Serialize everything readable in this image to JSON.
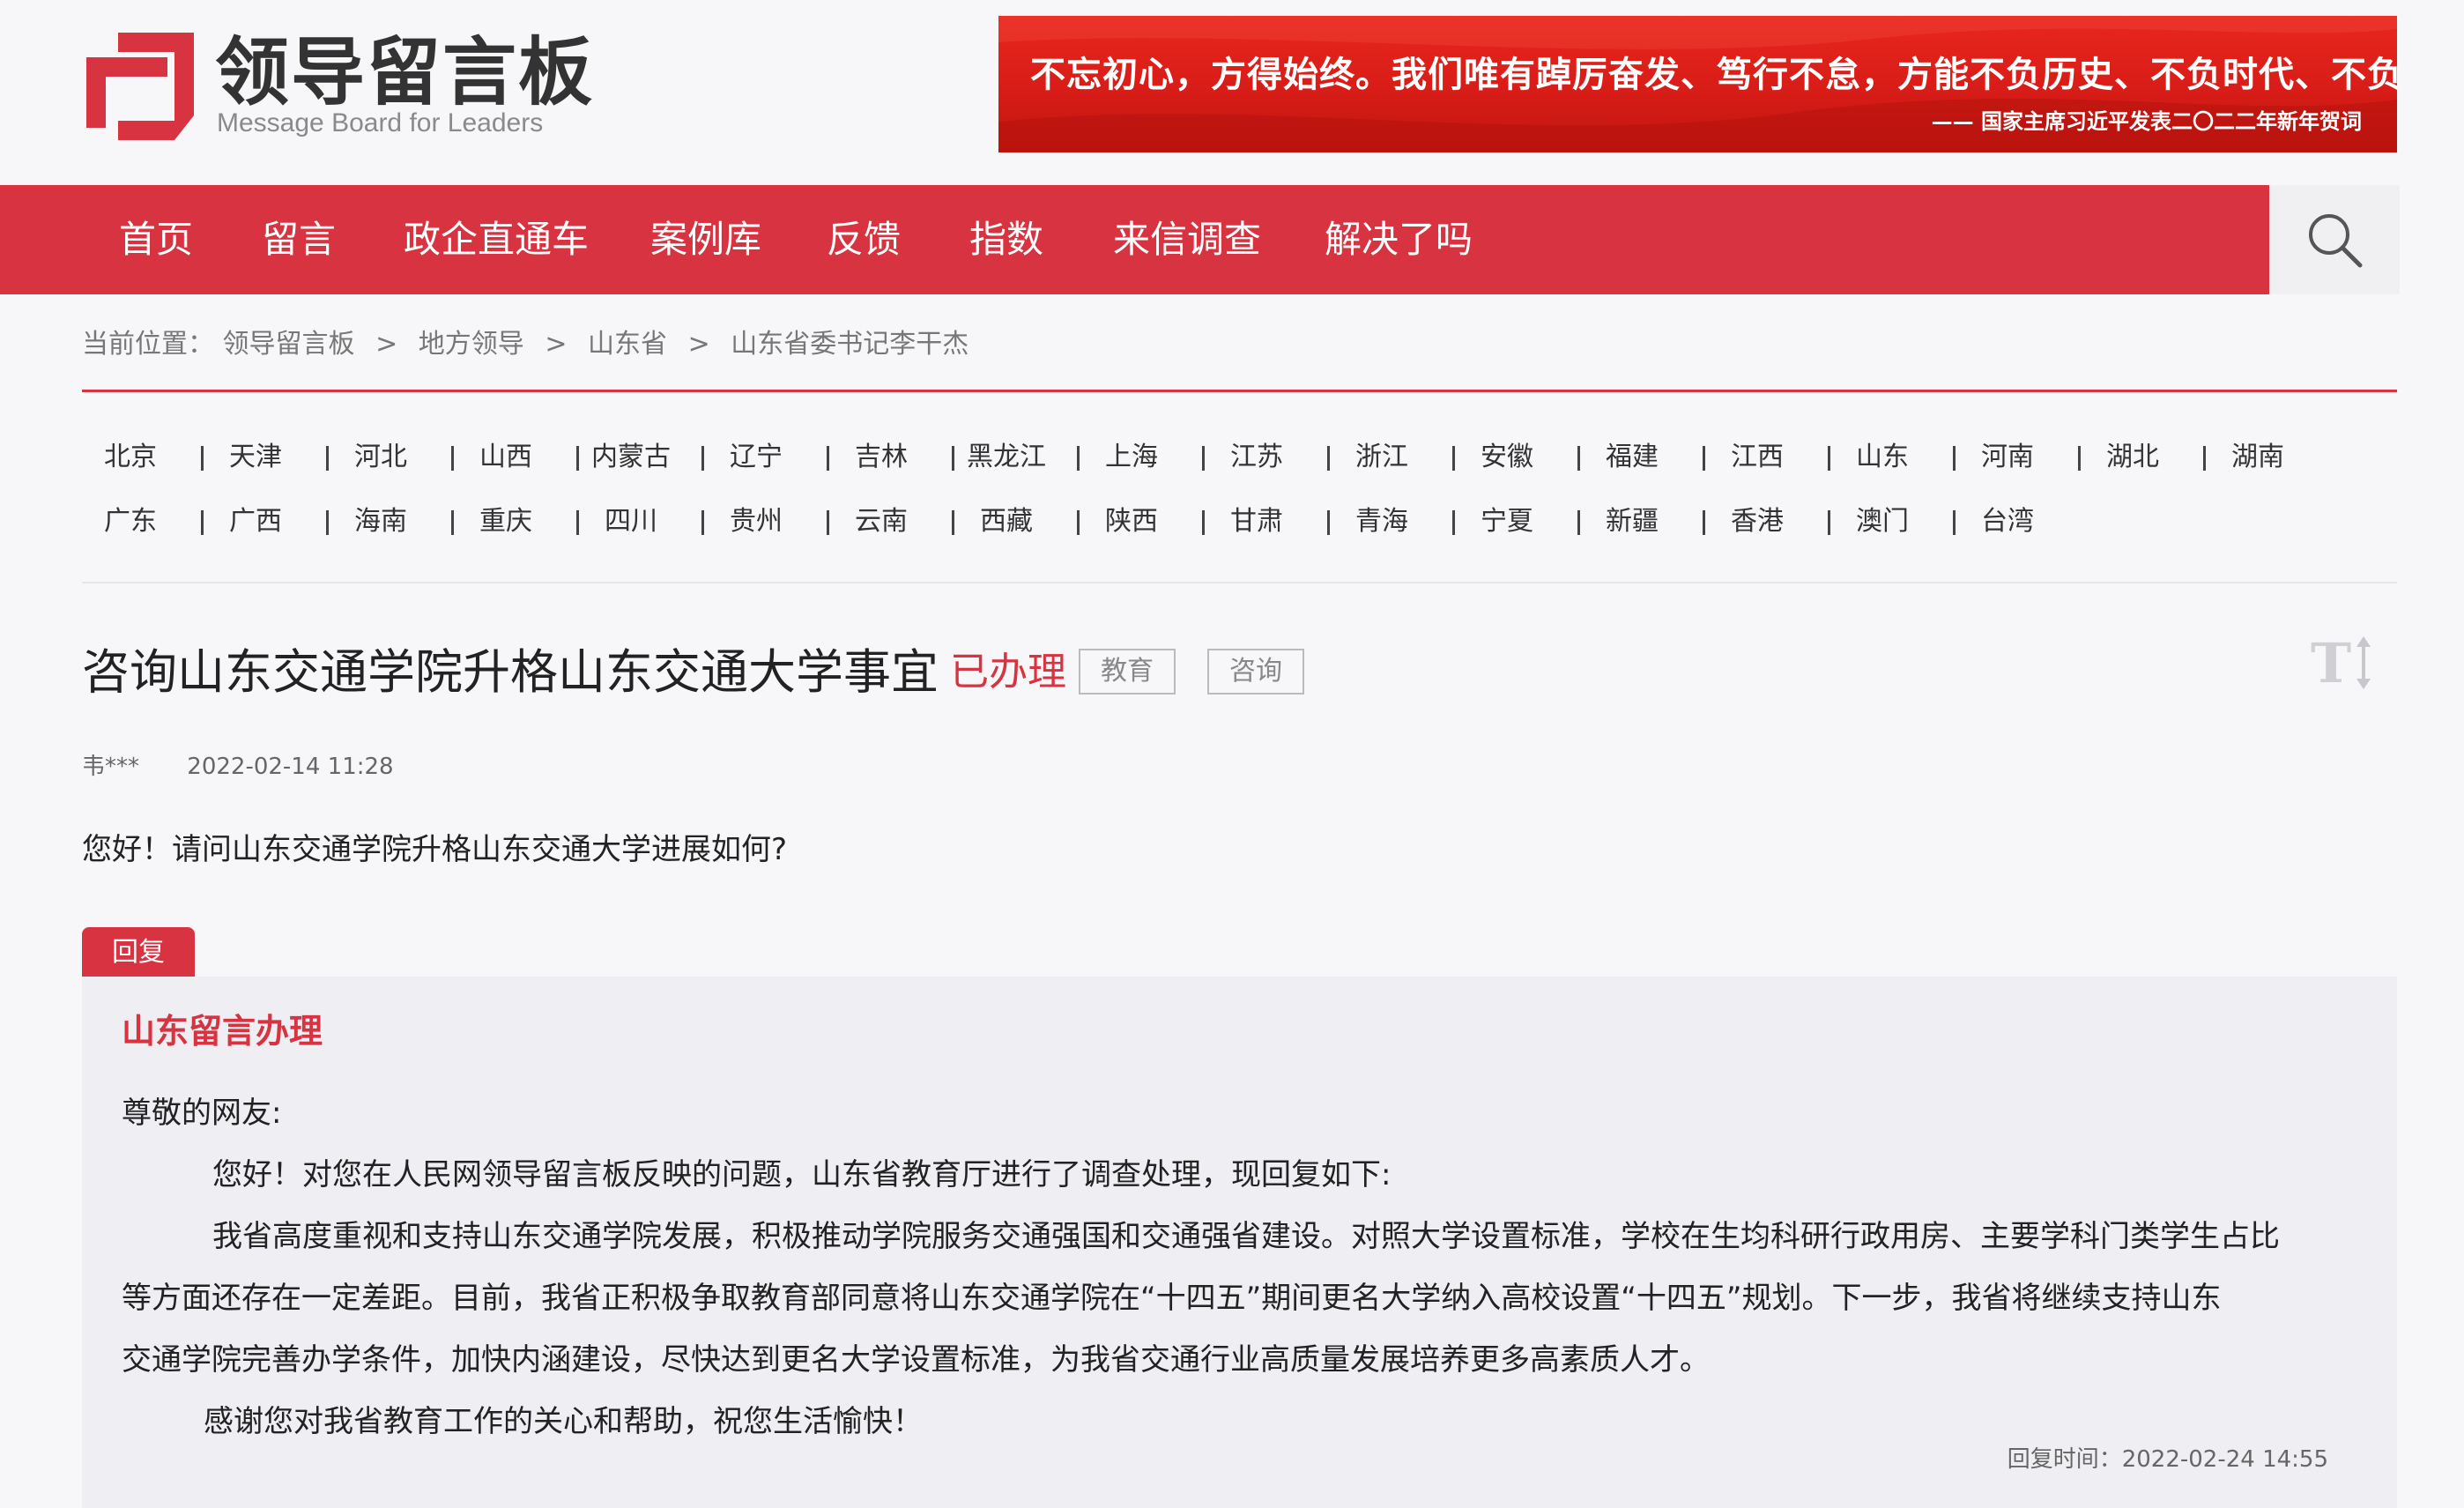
{
  "site": {
    "logo_title": "领导留言板",
    "logo_subtitle": "Message Board for Leaders"
  },
  "banner": {
    "line1": "不忘初心，方得始终。我们唯有踔厉奋发、笃行不怠，方能不负历史、不负时代、不负人民。",
    "line2": "—— 国家主席习近平发表二〇二二年新年贺词"
  },
  "nav": {
    "items": [
      "首页",
      "留言",
      "政企直通车",
      "案例库",
      "反馈",
      "指数",
      "来信调查",
      "解决了吗"
    ],
    "search_icon": "search-icon"
  },
  "breadcrumb": {
    "prefix": "当前位置：",
    "items": [
      "领导留言板",
      "地方领导",
      "山东省",
      "山东省委书记李干杰"
    ],
    "separator": ">"
  },
  "provinces": {
    "row1": [
      "北京",
      "天津",
      "河北",
      "山西",
      "内蒙古",
      "辽宁",
      "吉林",
      "黑龙江",
      "上海",
      "江苏",
      "浙江",
      "安徽",
      "福建",
      "江西",
      "山东",
      "河南",
      "湖北",
      "湖南"
    ],
    "row2": [
      "广东",
      "广西",
      "海南",
      "重庆",
      "四川",
      "贵州",
      "云南",
      "西藏",
      "陕西",
      "甘肃",
      "青海",
      "宁夏",
      "新疆",
      "香港",
      "澳门",
      "台湾"
    ]
  },
  "message": {
    "title": "咨询山东交通学院升格山东交通大学事宜",
    "status": "已办理",
    "tags": [
      "教育",
      "咨询"
    ],
    "author": "韦***",
    "date": "2022-02-14 11:28",
    "body": "您好！请问山东交通学院升格山东交通大学进展如何?"
  },
  "reply": {
    "tab_label": "回复",
    "from": "山东留言办理",
    "greeting": "尊敬的网友:",
    "para1": "您好！对您在人民网领导留言板反映的问题，山东省教育厅进行了调查处理，现回复如下:",
    "para2_line1": "我省高度重视和支持山东交通学院发展，积极推动学院服务交通强国和交通强省建设。对照大学设置标准，学校在生均科研行政用房、主要学科门类学生占比",
    "para2_line2": "等方面还存在一定差距。目前，我省正积极争取教育部同意将山东交通学院在“十四五”期间更名大学纳入高校设置“十四五”规划。下一步，我省将继续支持山东",
    "para2_line3": "交通学院完善办学条件，加快内涵建设，尽快达到更名大学设置标准，为我省交通行业高质量发展培养更多高素质人才。",
    "para3": "感谢您对我省教育工作的关心和帮助，祝您生活愉快！",
    "time_label": "回复时间：",
    "time": "2022-02-24 14:55"
  },
  "colors": {
    "brand_red": "#d73341",
    "banner_red": "#d81c17",
    "page_bg": "#f7f6f8",
    "reply_bg": "#eeeef3"
  }
}
